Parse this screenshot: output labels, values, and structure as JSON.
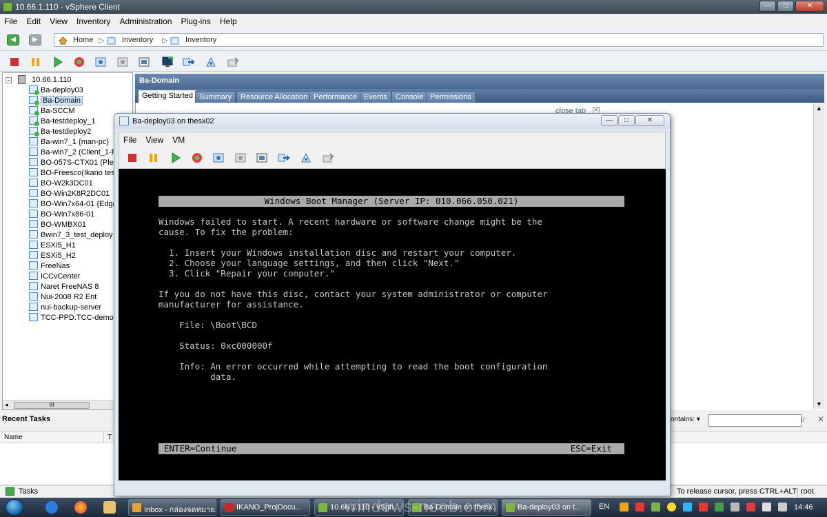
{
  "app": {
    "title": "10.66.1.110 - vSphere Client",
    "window_buttons": [
      "—",
      "□",
      "✕"
    ]
  },
  "menubar": [
    "File",
    "Edit",
    "View",
    "Inventory",
    "Administration",
    "Plug-ins",
    "Help"
  ],
  "breadcrumb": [
    "Home",
    "Inventory",
    "Inventory"
  ],
  "tree": {
    "root": "10.66.1.110",
    "items": [
      {
        "label": "Ba-deploy03",
        "on": true
      },
      {
        "label": "Ba-Domain",
        "on": true,
        "selected": true
      },
      {
        "label": "Ba-SCCM",
        "on": true
      },
      {
        "label": "Ba-testdeploy_1",
        "on": true
      },
      {
        "label": "Ba-testdeploy2",
        "on": true
      },
      {
        "label": "Ba-win7_1 {man-pc}",
        "on": false
      },
      {
        "label": "Ba-win7_2 (Client_1-F",
        "on": false
      },
      {
        "label": "BO-057S-CTX01 (Plea",
        "on": false
      },
      {
        "label": "BO-Freesco(Ikano tes",
        "on": false
      },
      {
        "label": "BO-W2k3DC01",
        "on": false
      },
      {
        "label": "BO-Win2K8R2DC01",
        "on": false
      },
      {
        "label": "BO-Win7x64-01 {Edga",
        "on": false
      },
      {
        "label": "BO-Win7x86-01",
        "on": false
      },
      {
        "label": "BO-WMBX01",
        "on": false
      },
      {
        "label": "Bwin7_3_test_deploy",
        "on": false
      },
      {
        "label": "ESXi5_H1",
        "on": false
      },
      {
        "label": "ESXi5_H2",
        "on": false
      },
      {
        "label": "FreeNas",
        "on": false
      },
      {
        "label": "ICCvCenter",
        "on": false
      },
      {
        "label": "Naret FreeNAS 8",
        "on": false
      },
      {
        "label": "Nui-2008 R2 Ent",
        "on": false
      },
      {
        "label": "nui-backup-server",
        "on": false
      },
      {
        "label": "TCC-PPD.TCC-demo.lo",
        "on": false
      }
    ],
    "scroll_thumb": "III"
  },
  "detail": {
    "title": "Ba-Domain",
    "tabs": [
      "Getting Started",
      "Summary",
      "Resource Allocation",
      "Performance",
      "Events",
      "Console",
      "Permissions"
    ],
    "close_tab": "close tab"
  },
  "recent_tasks": {
    "title": "Recent Tasks",
    "col_name": "Name",
    "col_t": "T",
    "filter_label": "contains: ▾",
    "clear": "Clear",
    "close": "✕"
  },
  "statusbar": {
    "tasks": "Tasks",
    "release": "To release cursor, press CTRL+ALT",
    "user": "root"
  },
  "console": {
    "title": "Ba-deploy03 on thesx02",
    "menu": [
      "File",
      "View",
      "VM"
    ],
    "buttons": [
      "—",
      "□",
      "✕"
    ],
    "boot": {
      "header": "Windows Boot Manager (Server IP: 010.066.050.021)",
      "lines": [
        "Windows failed to start. A recent hardware or software change might be the",
        "cause. To fix the problem:",
        "",
        "  1. Insert your Windows installation disc and restart your computer.",
        "  2. Choose your language settings, and then click \"Next.\"",
        "  3. Click \"Repair your computer.\"",
        "",
        "If you do not have this disc, contact your system administrator or computer",
        "manufacturer for assistance.",
        "",
        "    File: \\Boot\\BCD",
        "",
        "    Status: 0xc000000f",
        "",
        "    Info: An error occurred while attempting to read the boot configuration",
        "          data."
      ],
      "footer_left": "ENTER=Continue",
      "footer_right": "ESC=Exit"
    }
  },
  "taskbar": {
    "tasks": [
      "Inbox - กล่องจดหมาย...",
      "IKANO_ProjDocu...",
      "10.66.1.110 - vSph...",
      "Ba-Domain on thesx...",
      "Ba-deploy03 on t..."
    ],
    "lang": "EN",
    "clock": "14:46"
  },
  "watermark": "windows-noob.com",
  "colors": {
    "accent": "#4a6a92",
    "power_on": "#3fb24a",
    "stop": "#d32f2f",
    "pause": "#f5a300"
  }
}
